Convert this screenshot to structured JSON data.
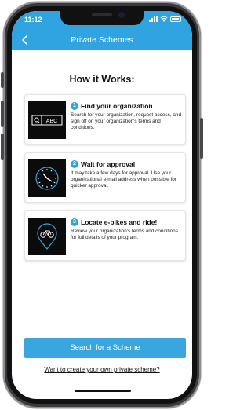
{
  "status_bar": {
    "time": "11:12"
  },
  "header": {
    "title": "Private Schemes",
    "accent": "#2fa4e0"
  },
  "main": {
    "heading": "How it Works:",
    "steps": [
      {
        "number": "1",
        "title": "Find your organization",
        "body": "Search for your organization, request access, and sign off on your organization's terms and conditions.",
        "icon": "search-field-icon",
        "thumb_text": "Q ABC"
      },
      {
        "number": "2",
        "title": "Wait for approval",
        "body": "It may take a few days for approval. Use your organizational e-mail address when possible for quicker approval.",
        "icon": "clock-icon"
      },
      {
        "number": "3",
        "title": "Locate e-bikes and ride!",
        "body": "Review your organization's terms and conditions for full details of your program.",
        "icon": "bike-location-pin-icon"
      }
    ]
  },
  "footer": {
    "search_button": "Search for a Scheme",
    "create_link": "Want to create your own private scheme?"
  }
}
